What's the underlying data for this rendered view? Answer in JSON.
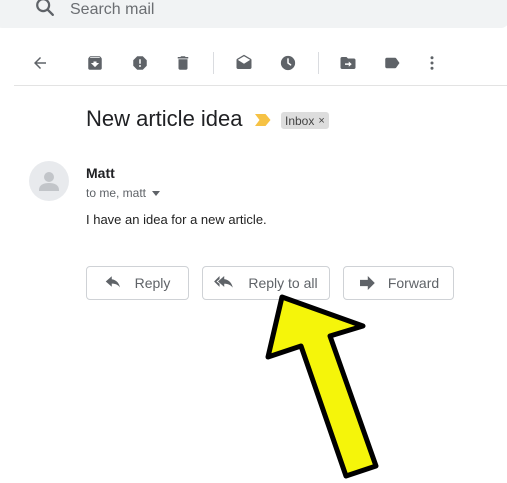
{
  "search": {
    "placeholder": "Search mail"
  },
  "toolbar": {
    "back": "back-arrow-icon",
    "archive": "archive-icon",
    "report_spam": "report-spam-icon",
    "delete": "trash-icon",
    "mark_unread": "mark-unread-icon",
    "snooze": "clock-icon",
    "move_to": "move-to-icon",
    "labels": "label-icon",
    "more": "more-vert-icon"
  },
  "message": {
    "subject": "New article idea",
    "label_chip": "Inbox",
    "label_chip_close": "×",
    "sender": "Matt",
    "recipients": "to me, matt",
    "body": "I have an idea for a new article."
  },
  "actions": {
    "reply": "Reply",
    "reply_all": "Reply to all",
    "forward": "Forward"
  },
  "colors": {
    "importance_marker": "#f6c244",
    "callout_arrow_fill": "#f5f50a",
    "callout_arrow_stroke": "#000000",
    "toolbar_icon": "#5f6368"
  }
}
